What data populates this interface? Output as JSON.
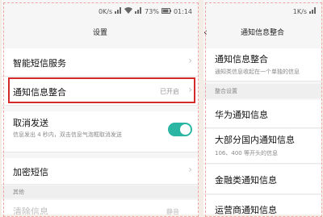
{
  "left": {
    "status": {
      "speed": "0K/s",
      "battery": "73%",
      "time": "01:14"
    },
    "title": "设置",
    "items": [
      {
        "title": "智能短信服务"
      },
      {
        "title": "通知信息整合",
        "status": "已开启"
      },
      {
        "title": "取消发送",
        "subtitle": "信息发出 4 秒内，双击信息气泡框取消发送",
        "toggle_on": true
      },
      {
        "title": "加密短信"
      }
    ],
    "section_other": "其他",
    "partial_item": "清除信息",
    "partial_status": "静音"
  },
  "right": {
    "status": {
      "speed": "1K/s"
    },
    "title": "通知信息整合",
    "header_item": {
      "title": "通知信息整合",
      "subtitle": "通知类信息收起在一个单独的信息"
    },
    "section": "整合设置",
    "items": [
      {
        "title": "华为通知信息"
      },
      {
        "title": "大部分国内通知信息",
        "subtitle": "106、400 等开头的信息"
      },
      {
        "title": "金融类通知信息"
      },
      {
        "title": "运营商通知信息"
      }
    ]
  },
  "colors": {
    "accent": "#2bb6a3",
    "highlight": "#d42a2a"
  }
}
